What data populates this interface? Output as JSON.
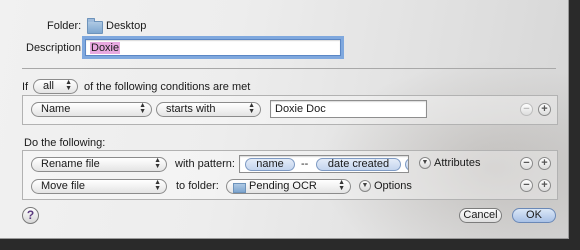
{
  "header": {
    "folder_label": "Folder:",
    "folder_name": "Desktop",
    "description_label": "Description:",
    "description_value": "Doxie"
  },
  "conditions": {
    "if_label": "If",
    "match_value": "all",
    "suffix": "of the following conditions are met",
    "rows": [
      {
        "attribute": "Name",
        "operator": "starts with",
        "value": "Doxie Doc"
      }
    ]
  },
  "actions": {
    "heading": "Do the following:",
    "rows": [
      {
        "action": "Rename file",
        "connector": "with pattern:",
        "tokens": [
          "name",
          "--",
          "date created"
        ],
        "extra_label": "Attributes"
      },
      {
        "action": "Move file",
        "connector": "to folder:",
        "folder": "Pending OCR",
        "extra_label": "Options"
      }
    ]
  },
  "footer": {
    "help_label": "?",
    "cancel_label": "Cancel",
    "ok_label": "OK"
  },
  "icons": {
    "add": "+",
    "remove": "−",
    "disclosure": "▼",
    "popup_arrows": "▲▼"
  },
  "colors": {
    "selection": "#e8a9e0",
    "focus_ring": "#7fa8de",
    "default_button": "#a8c1e6"
  }
}
